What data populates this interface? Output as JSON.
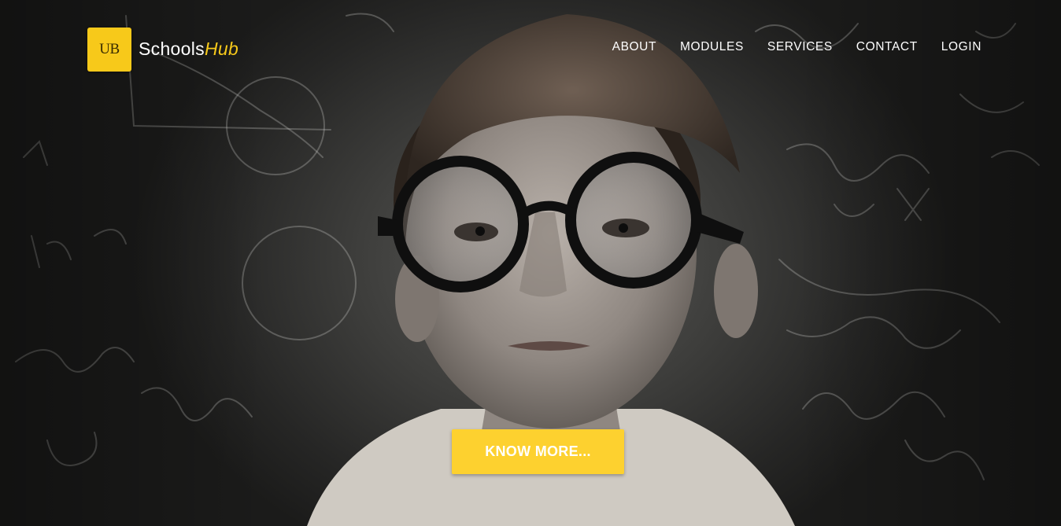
{
  "header": {
    "logo_badge_text": "UB",
    "logo_name": "Schools",
    "logo_name_accent": "Hub"
  },
  "nav": {
    "items": [
      {
        "label": "ABOUT"
      },
      {
        "label": "MODULES"
      },
      {
        "label": "SERVICES"
      },
      {
        "label": "CONTACT"
      },
      {
        "label": "LOGIN"
      }
    ]
  },
  "hero": {
    "image": "boy-with-round-glasses-in-front-of-chalkboard",
    "cta_label": "KNOW MORE..."
  },
  "colors": {
    "accent": "#f7c91a",
    "button": "#fdd12f",
    "nav_text": "#ffffff"
  }
}
